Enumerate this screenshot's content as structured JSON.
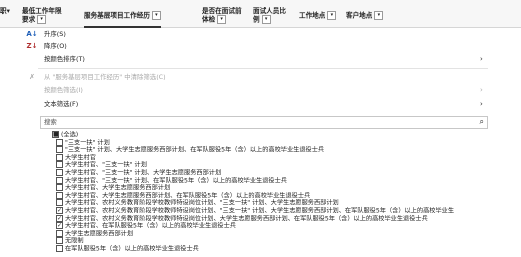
{
  "headers": [
    {
      "label": "职▾",
      "dropdown": false
    },
    {
      "label": "最低工作年限要求",
      "dropdown": true
    },
    {
      "label": "服务基层项目工作经历",
      "dropdown": true,
      "selected": true
    },
    {
      "label": "是否在面试前体检",
      "dropdown": true
    },
    {
      "label": "面试人员比例",
      "dropdown": true
    },
    {
      "label": "工作地点",
      "dropdown": true
    },
    {
      "label": "客户地点",
      "dropdown": true
    }
  ],
  "dropdown_glyph": "▾",
  "menu": {
    "sort_asc": {
      "icon": "A↓",
      "label": "升序(S)"
    },
    "sort_desc": {
      "icon": "Z↓",
      "label": "降序(O)"
    },
    "sort_by_color": {
      "label": "按颜色排序(T)",
      "arrow": "›"
    },
    "clear_filter": {
      "icon": "✗",
      "label": "从 \"服务基层项目工作经历\" 中清除筛选(C)"
    },
    "filter_by_color": {
      "label": "按颜色筛选(I)",
      "arrow": "›"
    },
    "text_filters": {
      "label": "文本筛选(F)",
      "arrow": "›"
    }
  },
  "search": {
    "placeholder": "搜索",
    "icon": "⌕"
  },
  "checklist": [
    {
      "label": "(全选)",
      "checked": "partial",
      "indent": 0
    },
    {
      "label": "\"三支一扶\" 计划",
      "checked": false,
      "indent": 1
    },
    {
      "label": "\"三支一扶\" 计划、大学生志愿服务西部计划、在军队服役5年（含）以上的高校毕业生退役士兵",
      "checked": false,
      "indent": 1
    },
    {
      "label": "大学生村官",
      "checked": false,
      "indent": 1
    },
    {
      "label": "大学生村官、\"三支一扶\" 计划",
      "checked": false,
      "indent": 1
    },
    {
      "label": "大学生村官、\"三支一扶\" 计划、大学生志愿服务西部计划",
      "checked": false,
      "indent": 1
    },
    {
      "label": "大学生村官、\"三支一扶\" 计划、在军队服役5年（含）以上的高校毕业生退役士兵",
      "checked": false,
      "indent": 1
    },
    {
      "label": "大学生村官、大学生志愿服务西部计划",
      "checked": false,
      "indent": 1
    },
    {
      "label": "大学生村官、大学生志愿服务西部计划、在军队服役5年（含）以上的高校毕业生退役士兵",
      "checked": false,
      "indent": 1
    },
    {
      "label": "大学生村官、农村义务教育阶段学校教师特设岗位计划、\"三支一扶\" 计划、大学生志愿服务西部计划",
      "checked": false,
      "indent": 1
    },
    {
      "label": "大学生村官、农村义务教育阶段学校教师特设岗位计划、\"三支一扶\" 计划、大学生志愿服务西部计划、在军队服役5年（含）以上的高校毕业生",
      "checked": true,
      "indent": 1
    },
    {
      "label": "大学生村官、农村义务教育阶段学校教师特设岗位计划、大学生志愿服务西部计划、在军队服役5年（含）以上的高校毕业生退役士兵",
      "checked": true,
      "indent": 1
    },
    {
      "label": "大学生村官、在军队服役5年（含）以上的高校毕业生退役士兵",
      "checked": true,
      "indent": 1
    },
    {
      "label": "大学生志愿服务西部计划",
      "checked": false,
      "indent": 1
    },
    {
      "label": "无限制",
      "checked": false,
      "indent": 1
    },
    {
      "label": "在军队服役5年（含）以上的高校毕业生退役士兵",
      "checked": false,
      "indent": 1
    }
  ],
  "check_glyphs": {
    "true": "✓",
    "false": "",
    "partial": "■"
  }
}
